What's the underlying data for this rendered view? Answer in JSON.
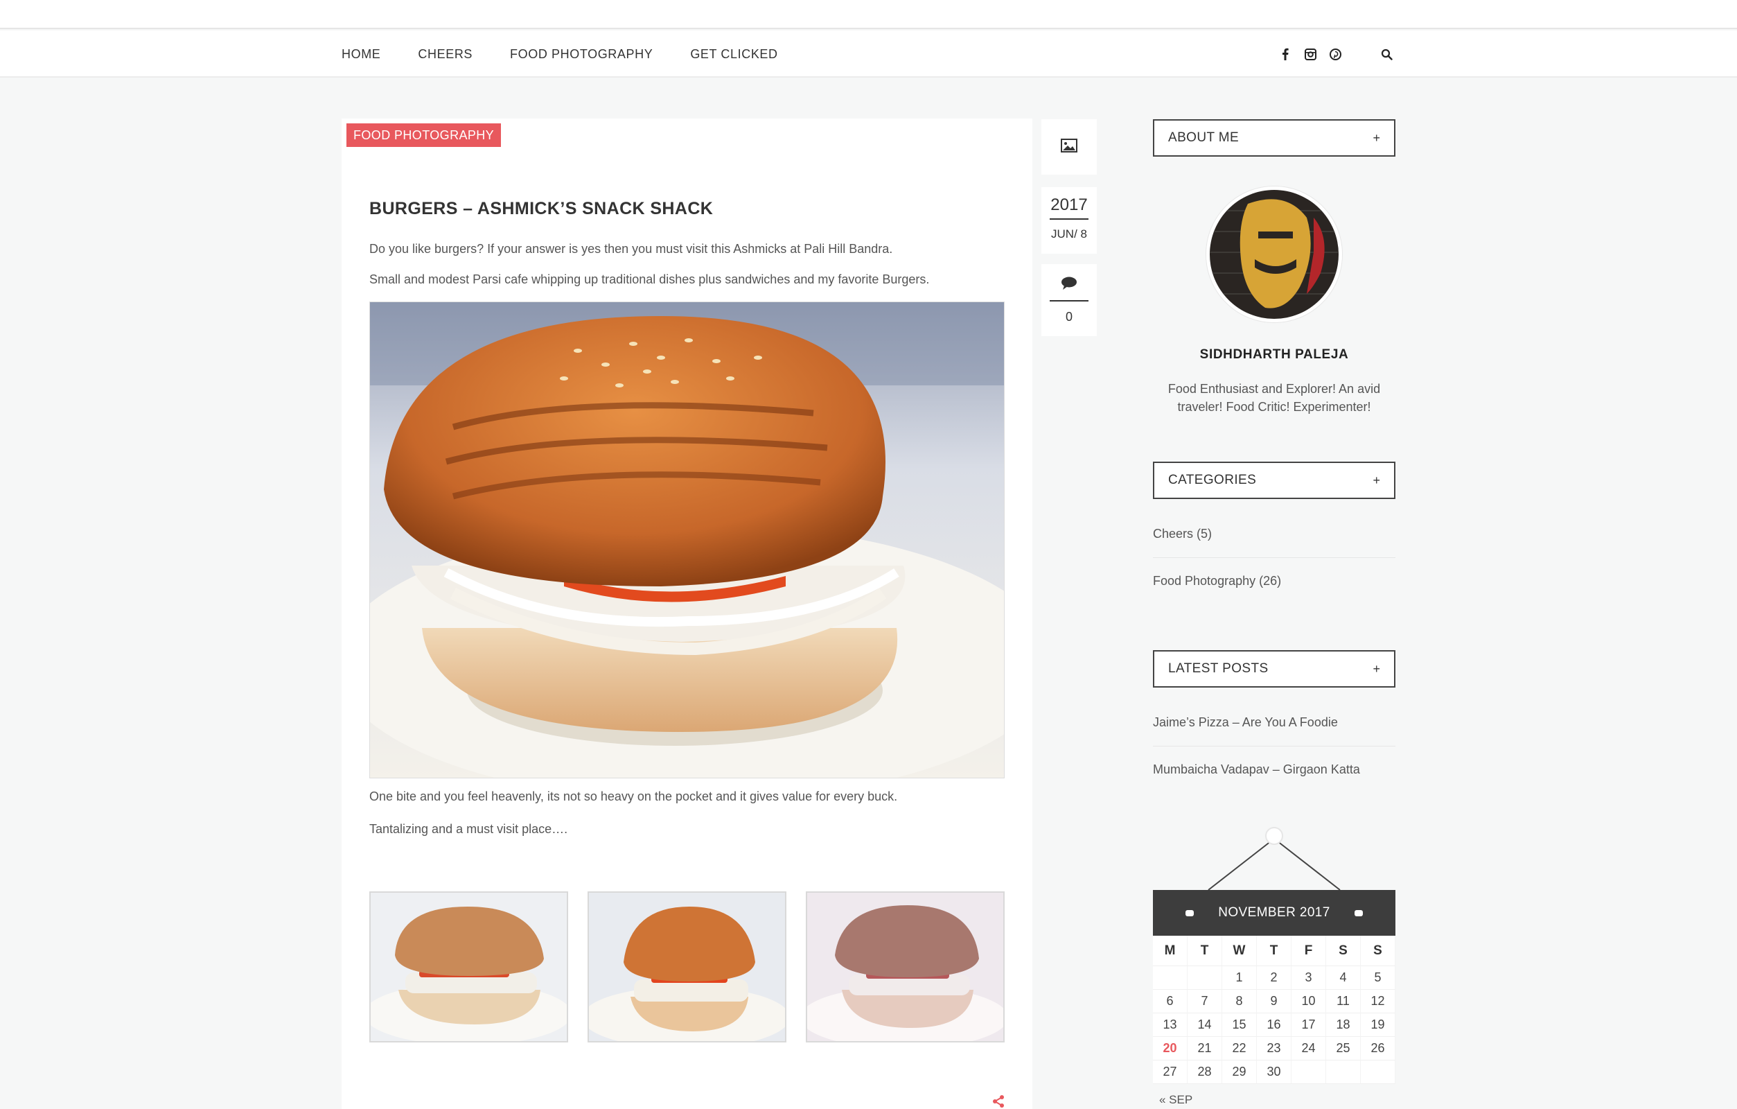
{
  "nav": {
    "items": [
      "HOME",
      "CHEERS",
      "FOOD PHOTOGRAPHY",
      "GET CLICKED"
    ],
    "icons": [
      "facebook-icon",
      "instagram-icon",
      "pinterest-icon",
      "search-icon"
    ]
  },
  "post": {
    "category": "FOOD PHOTOGRAPHY",
    "title": "BURGERS – ASHMICK’S SNACK SHACK",
    "paragraphs": [
      "Do you like burgers? If your answer is yes then you must visit this Ashmicks at Pali Hill Bandra.",
      "Small and modest Parsi cafe whipping up traditional dishes plus sandwiches and my favorite Burgers.",
      "One bite and you feel heavenly, its not so heavy on the pocket and it gives value for every buck.",
      "Tantalizing and a must visit place…."
    ],
    "year": "2017",
    "day": "JUN/ 8",
    "comments": "0"
  },
  "sidebar": {
    "about_title": "ABOUT ME",
    "author": "SIDHDHARTH PALEJA",
    "bio": "Food Enthusiast and Explorer! An avid traveler! Food Critic! Experimenter!",
    "categories_title": "CATEGORIES",
    "categories": [
      "Cheers (5)",
      "Food Photography (26)"
    ],
    "latest_title": "LATEST POSTS",
    "latest": [
      "Jaime’s Pizza – Are You A Foodie",
      "Mumbaicha Vadapav – Girgaon Katta"
    ],
    "plus": "+"
  },
  "calendar": {
    "month": "NOVEMBER 2017",
    "weekdays": [
      "M",
      "T",
      "W",
      "T",
      "F",
      "S",
      "S"
    ],
    "weeks": [
      [
        "",
        "",
        "1",
        "2",
        "3",
        "4",
        "5"
      ],
      [
        "6",
        "7",
        "8",
        "9",
        "10",
        "11",
        "12"
      ],
      [
        "13",
        "14",
        "15",
        "16",
        "17",
        "18",
        "19"
      ],
      [
        "20",
        "21",
        "22",
        "23",
        "24",
        "25",
        "26"
      ],
      [
        "27",
        "28",
        "29",
        "30",
        "",
        "",
        ""
      ]
    ],
    "today": "20",
    "prev_link": "« SEP"
  },
  "colors": {
    "accent": "#e8585d",
    "calendar_header": "#3d3d3d"
  }
}
